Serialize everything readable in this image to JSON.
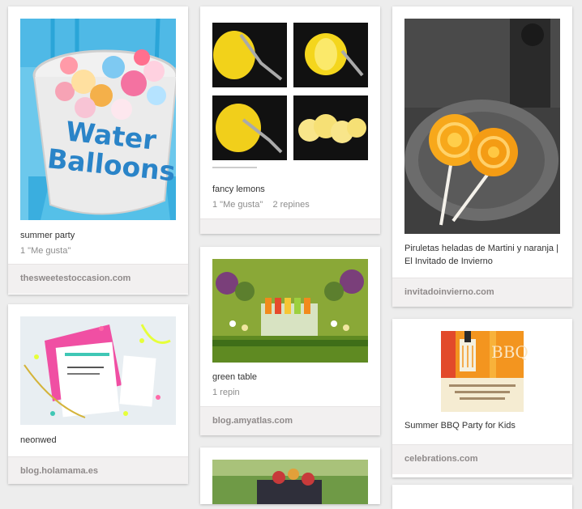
{
  "pins": [
    {
      "id": "water-balloons",
      "description": "summer party",
      "stats": "1 \"Me gusta\"",
      "source": "thesweetestoccasion.com",
      "image_text": "Water Balloons",
      "image_text_color": "#2a84c8"
    },
    {
      "id": "fancy-lemons",
      "description": "fancy lemons",
      "stats": "1 \"Me gusta\"    2 repines",
      "source": ""
    },
    {
      "id": "lollipops",
      "description": "Piruletas heladas de Martini y naranja | El Invitado de Invierno",
      "stats": "",
      "source": "invitadoinvierno.com"
    },
    {
      "id": "neonwed",
      "description": "neonwed",
      "stats": "",
      "source": "blog.holamama.es"
    },
    {
      "id": "green-table",
      "description": "green table",
      "stats": "1 repin",
      "source": "blog.amyatlas.com"
    },
    {
      "id": "bbq",
      "description": "Summer BBQ Party for Kids",
      "stats": "",
      "source": "celebrations.com",
      "image_text": "BBQ"
    }
  ],
  "colors": {
    "background": "#ededed",
    "card": "#ffffff",
    "footer": "#f2f0f0",
    "source_text": "#8f8a8a",
    "stats_text": "#8c8c8c"
  }
}
